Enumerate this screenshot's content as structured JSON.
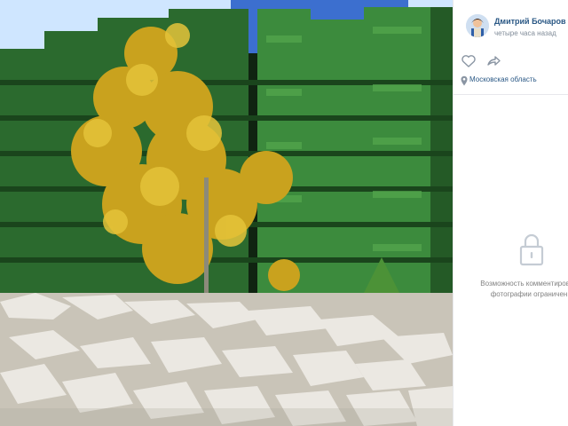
{
  "post": {
    "author_name": "Дмитрий Бочаров",
    "time_ago": "четыре часа назад",
    "location": "Московская область"
  },
  "comments": {
    "locked_line1": "Возможность комментирован",
    "locked_line2": "фотографии ограничен"
  },
  "icons": {
    "like": "heart-icon",
    "share": "share-arrow-icon",
    "location": "location-pin-icon",
    "lock": "lock-icon"
  },
  "colors": {
    "link": "#2a5885",
    "muted": "#818c99",
    "divider": "#e7e8ec"
  }
}
